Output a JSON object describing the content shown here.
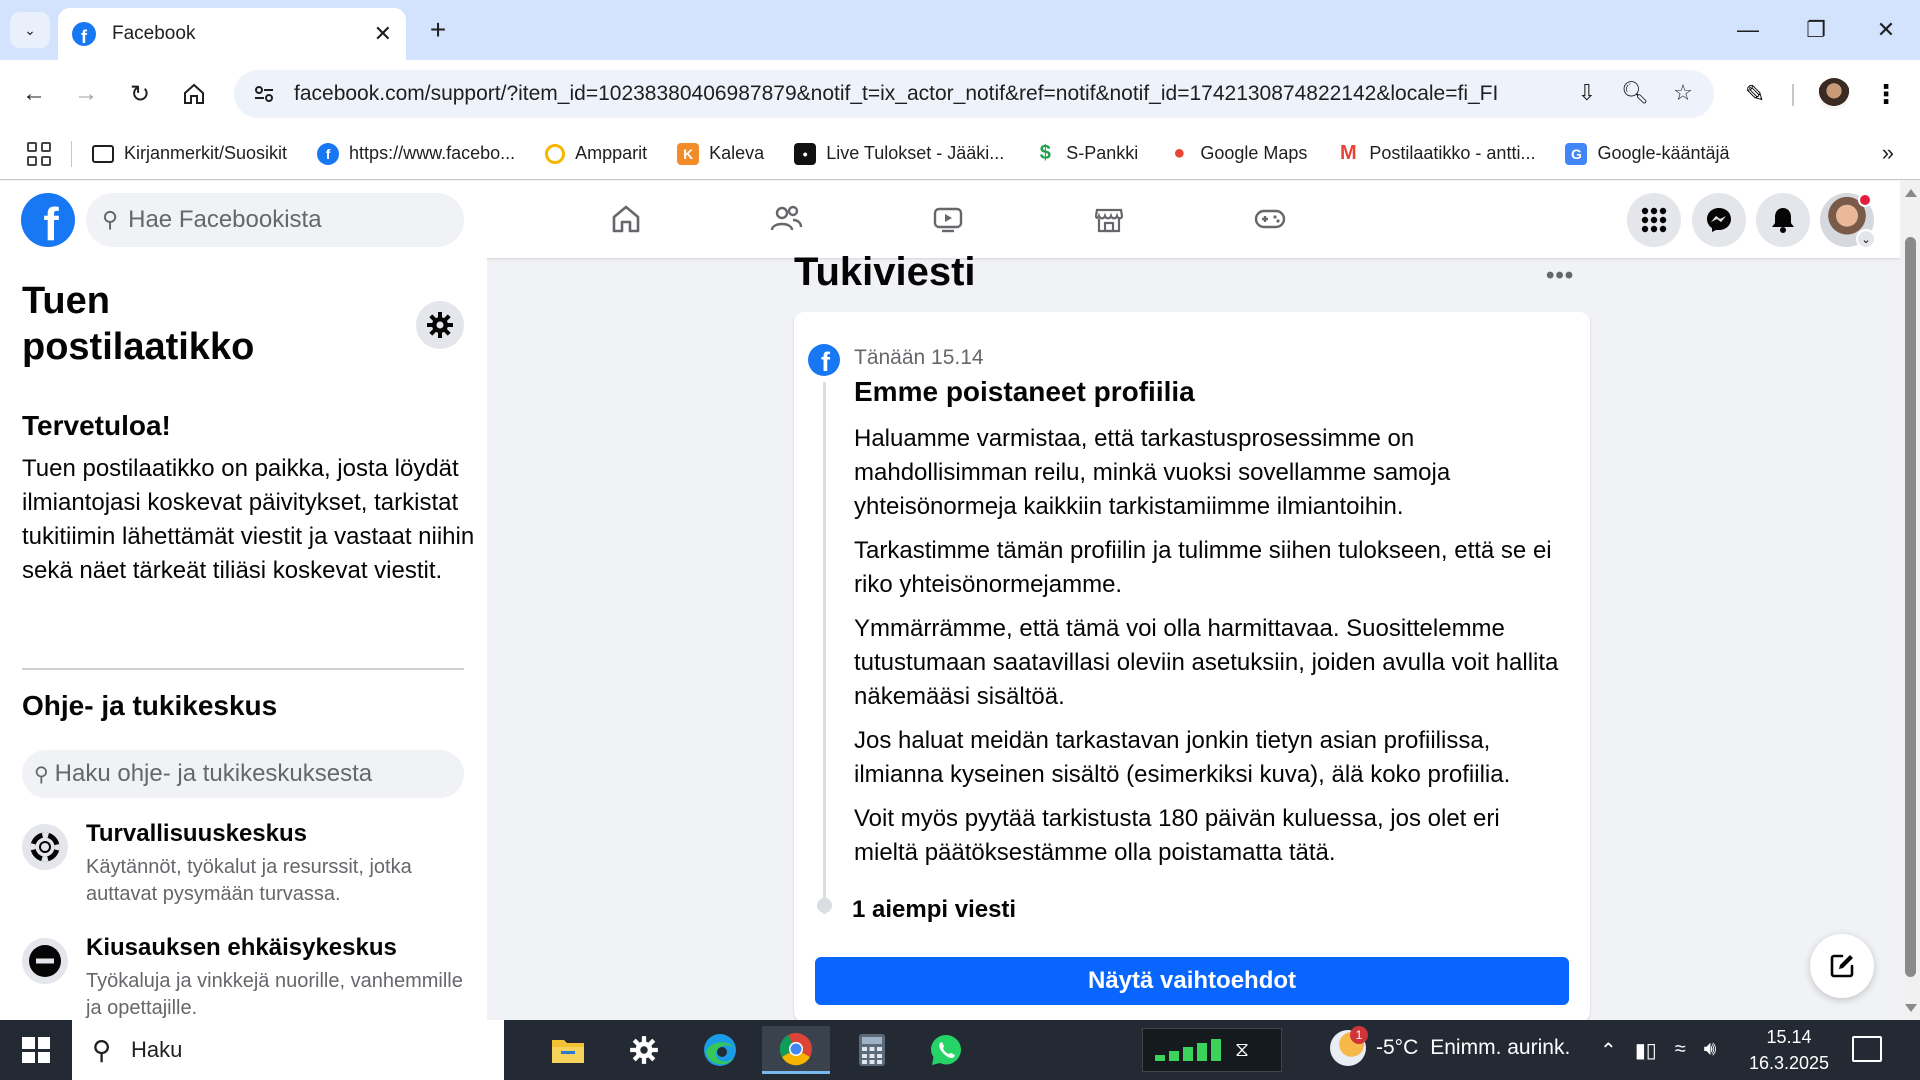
{
  "browser": {
    "tab": {
      "title": "Facebook"
    },
    "url": "facebook.com/support/?item_id=10238380406987879&notif_t=ix_actor_notif&ref=notif&notif_id=1742130874822142&locale=fi_FI",
    "bookmarks": [
      {
        "label": "Kirjanmerkit/Suosikit",
        "icon": "folder-icon",
        "color": "#1f1f1f"
      },
      {
        "label": "https://www.facebo...",
        "icon": "facebook-icon",
        "color": "#1877f2"
      },
      {
        "label": "Ampparit",
        "icon": "ampparit-icon",
        "color": "#f5b800"
      },
      {
        "label": "Kaleva",
        "icon": "kaleva-icon",
        "color": "#f28c28"
      },
      {
        "label": "Live Tulokset - Jääki...",
        "icon": "livetulokset-icon",
        "color": "#111111"
      },
      {
        "label": "S-Pankki",
        "icon": "spankki-icon",
        "color": "#1fa14a"
      },
      {
        "label": "Google Maps",
        "icon": "google-maps-icon",
        "color": "#ea4335"
      },
      {
        "label": "Postilaatikko - antti...",
        "icon": "gmail-icon",
        "color": "#ea4335"
      },
      {
        "label": "Google-kääntäjä",
        "icon": "google-translate-icon",
        "color": "#4285f4"
      }
    ]
  },
  "fb": {
    "search_placeholder": "Hae Facebookista",
    "brand_color": "#1877f2"
  },
  "sidebar": {
    "title": "Tuen postilaatikko",
    "welcome_heading": "Tervetuloa!",
    "welcome_text": "Tuen postilaatikko on paikka, josta löydät ilmiantojasi koskevat päivitykset, tarkistat tukitiimin lähettämät viestit ja vastaat niihin sekä näet tärkeät tiliäsi koskevat viestit.",
    "help_heading": "Ohje- ja tukikeskus",
    "help_search_placeholder": "Haku ohje- ja tukikeskuksesta",
    "items": [
      {
        "title": "Turvallisuuskeskus",
        "desc": "Käytännöt, työkalut ja resurssit, jotka auttavat pysymään turvassa.",
        "icon": "lifebuoy-icon"
      },
      {
        "title": "Kiusauksen ehkäisykeskus",
        "desc": "Työkaluja ja vinkkejä nuorille, vanhemmille ja opettajille.",
        "icon": "no-entry-icon"
      }
    ]
  },
  "main": {
    "title": "Tukiviesti",
    "message": {
      "time": "Tänään 15.14",
      "title": "Emme poistaneet profiilia",
      "paragraphs": [
        "Haluamme varmistaa, että tarkastusprosessimme on mahdollisimman reilu, minkä vuoksi sovellamme samoja yhteisönormeja kaikkiin tarkistamiimme ilmiantoihin.",
        "Tarkastimme tämän profiilin ja tulimme siihen tulokseen, että se ei riko yhteisönormejamme.",
        "Ymmärrämme, että tämä voi olla harmittavaa. Suosittelemme tutustumaan saatavillasi oleviin asetuksiin, joiden avulla voit hallita näkemääsi sisältöä.",
        "Jos haluat meidän tarkastavan jonkin tietyn asian profiilissa, ilmianna kyseinen sisältö (esimerkiksi kuva), älä koko profiilia.",
        "Voit myös pyytää tarkistusta 180 päivän kuluessa, jos olet eri mieltä päätöksestämme olla poistamatta tätä."
      ],
      "previous": "1 aiempi viesti",
      "button": "Näytä vaihtoehdot",
      "button_color": "#0866ff"
    }
  },
  "taskbar": {
    "search_placeholder": "Haku",
    "weather": {
      "temp": "-5°C",
      "desc": "Enimm. aurink.",
      "badge": "1"
    },
    "clock": {
      "time": "15.14",
      "date": "16.3.2025"
    },
    "apps": [
      "file-explorer-icon",
      "settings-icon",
      "edge-icon",
      "chrome-icon",
      "calculator-icon",
      "whatsapp-icon"
    ]
  }
}
